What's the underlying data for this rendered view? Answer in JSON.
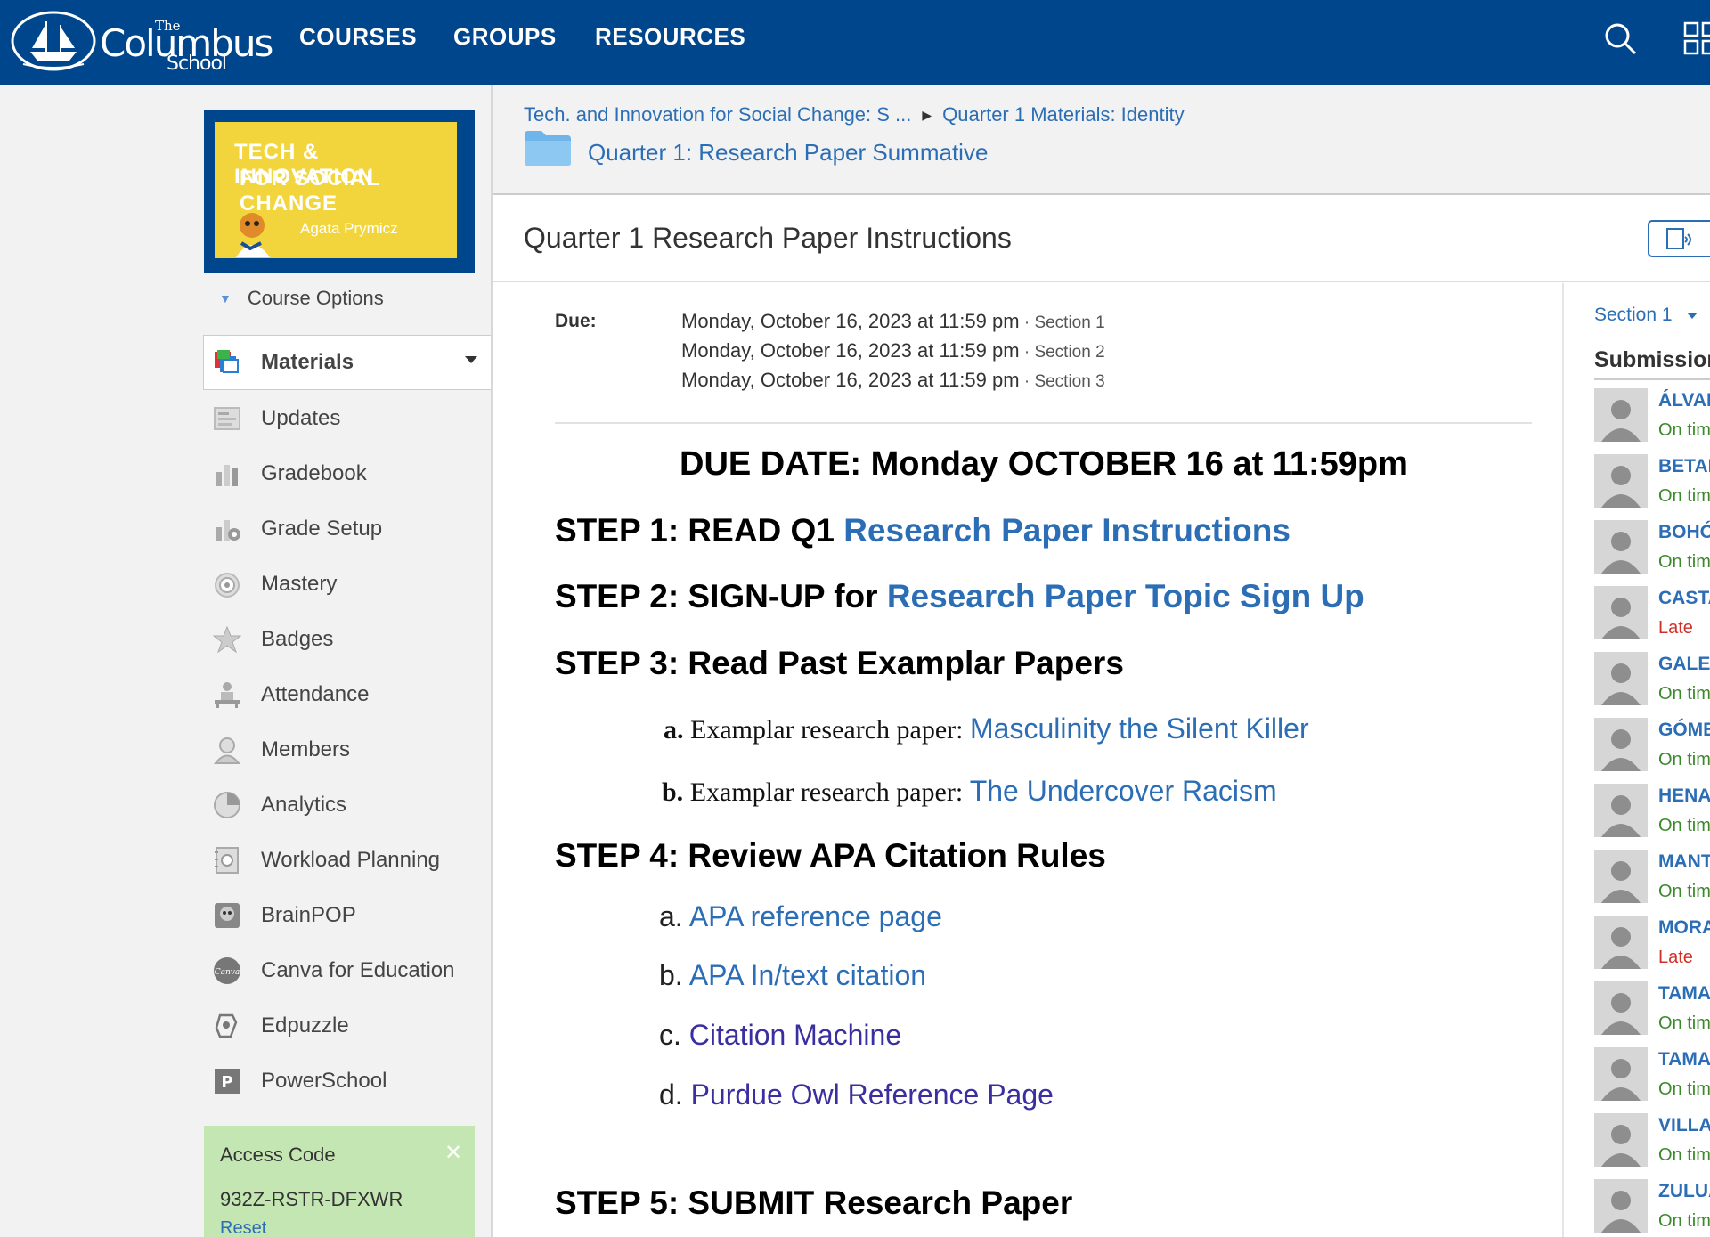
{
  "header": {
    "logo_the": "The",
    "logo_name": "Columbus",
    "logo_school": "School",
    "nav": [
      "COURSES",
      "GROUPS",
      "RESOURCES"
    ]
  },
  "course_card": {
    "line1": "TECH & INNOVATION",
    "line2": "FOR SOCIAL CHANGE",
    "teacher": "Agata Prymicz"
  },
  "sidebar": {
    "course_options": "Course Options",
    "items": [
      {
        "label": "Materials",
        "icon": "materials-icon"
      },
      {
        "label": "Updates",
        "icon": "updates-icon"
      },
      {
        "label": "Gradebook",
        "icon": "gradebook-icon"
      },
      {
        "label": "Grade Setup",
        "icon": "grade-setup-icon"
      },
      {
        "label": "Mastery",
        "icon": "mastery-icon"
      },
      {
        "label": "Badges",
        "icon": "badges-icon"
      },
      {
        "label": "Attendance",
        "icon": "attendance-icon"
      },
      {
        "label": "Members",
        "icon": "members-icon"
      },
      {
        "label": "Analytics",
        "icon": "analytics-icon"
      },
      {
        "label": "Workload Planning",
        "icon": "workload-planning-icon"
      },
      {
        "label": "BrainPOP",
        "icon": "brainpop-icon"
      },
      {
        "label": "Canva for Education",
        "icon": "canva-icon"
      },
      {
        "label": "Edpuzzle",
        "icon": "edpuzzle-icon"
      },
      {
        "label": "PowerSchool",
        "icon": "powerschool-icon"
      }
    ],
    "access": {
      "title": "Access Code",
      "code": "932Z-RSTR-DFXWR",
      "reset": "Reset"
    }
  },
  "breadcrumb": {
    "course": "Tech. and Innovation for Social Change: S ...",
    "folder": "Quarter 1 Materials: Identity",
    "current": "Quarter 1: Research Paper Summative"
  },
  "page": {
    "title": "Quarter 1 Research Paper Instructions",
    "due_label": "Due:",
    "due": [
      {
        "date": "Monday, October 16, 2023 at 11:59 pm",
        "section": "Section 1"
      },
      {
        "date": "Monday, October 16, 2023 at 11:59 pm",
        "section": "Section 2"
      },
      {
        "date": "Monday, October 16, 2023 at 11:59 pm",
        "section": "Section 3"
      }
    ],
    "due_banner": "DUE DATE: Monday OCTOBER 16 at 11:59pm",
    "step1_text": "STEP 1: READ Q1 ",
    "step1_link": "Research Paper Instructions",
    "step2_text": "STEP 2: SIGN-UP for ",
    "step2_link": "Research Paper Topic Sign Up",
    "step3_text": "STEP 3: Read Past Examplar Papers",
    "step3_items": [
      {
        "letter": "a.",
        "text": " Examplar research paper: ",
        "link": "Masculinity the Silent Killer"
      },
      {
        "letter": "b.",
        "text": " Examplar research paper: ",
        "link": "The Undercover Racism"
      }
    ],
    "step4_text": "STEP 4: Review APA Citation Rules",
    "step4_items": [
      {
        "letter": "a.",
        "link": "APA reference page"
      },
      {
        "letter": "b.",
        "link": "APA In/text citation"
      },
      {
        "letter": "c.",
        "link": "Citation Machine"
      },
      {
        "letter": "d.",
        "link": "Purdue Owl Reference Page"
      }
    ],
    "step5_text": "STEP 5: SUBMIT Research Paper"
  },
  "submissions": {
    "section_selector": "Section 1",
    "title": "Submissions",
    "students": [
      {
        "name": "ÁLVAF",
        "status": "On tim"
      },
      {
        "name": "BETAN",
        "status": "On tim"
      },
      {
        "name": "BOHÓ",
        "status": "On tim"
      },
      {
        "name": "CASTA",
        "status": "Late"
      },
      {
        "name": "GALEA",
        "status": "On tim"
      },
      {
        "name": "GÓME",
        "status": "On tim"
      },
      {
        "name": "HENA",
        "status": "On tim"
      },
      {
        "name": "MANT",
        "status": "On tim"
      },
      {
        "name": "MORA",
        "status": "Late"
      },
      {
        "name": "TAMA",
        "status": "On tim"
      },
      {
        "name": "TAMA",
        "status": "On tim"
      },
      {
        "name": "VILLA",
        "status": "On tim"
      },
      {
        "name": "ZULUA",
        "status": "On tim"
      }
    ]
  },
  "colors": {
    "header_bg": "#00468c",
    "link": "#2c6eb5",
    "visited_link": "#3a2ea0",
    "on_time": "#3a8a2a",
    "late": "#d0302a",
    "access_bg": "#c3e6b2",
    "card_yellow": "#f2d53c"
  }
}
